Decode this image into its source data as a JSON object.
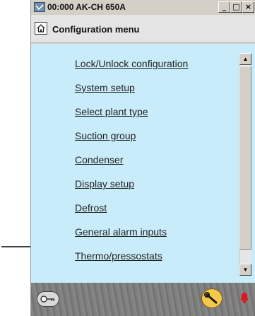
{
  "window": {
    "title": "00:000 AK-CH 650A",
    "controls": {
      "minimize": "_",
      "maximize": "□",
      "close": "×"
    }
  },
  "header": {
    "title": "Configuration menu",
    "icon": "home-icon"
  },
  "menu": {
    "items": [
      "Lock/Unlock configuration",
      "System setup",
      "Select plant type",
      "Suction group",
      "Condenser",
      "Display setup",
      "Defrost",
      "General alarm inputs",
      "Thermo/pressostats"
    ],
    "pointed_item": "Thermo/pressostats"
  },
  "scrollbar": {
    "up": "▲",
    "down": "▼"
  },
  "footer": {
    "icons": [
      "key-icon",
      "wrench-icon",
      "alarm-bell-icon"
    ]
  },
  "colors": {
    "content_bg": "#c9ecfa",
    "window_bg": "#d4d0c8",
    "alarm": "#e0141a",
    "wrench_button": "#f4c84a"
  }
}
